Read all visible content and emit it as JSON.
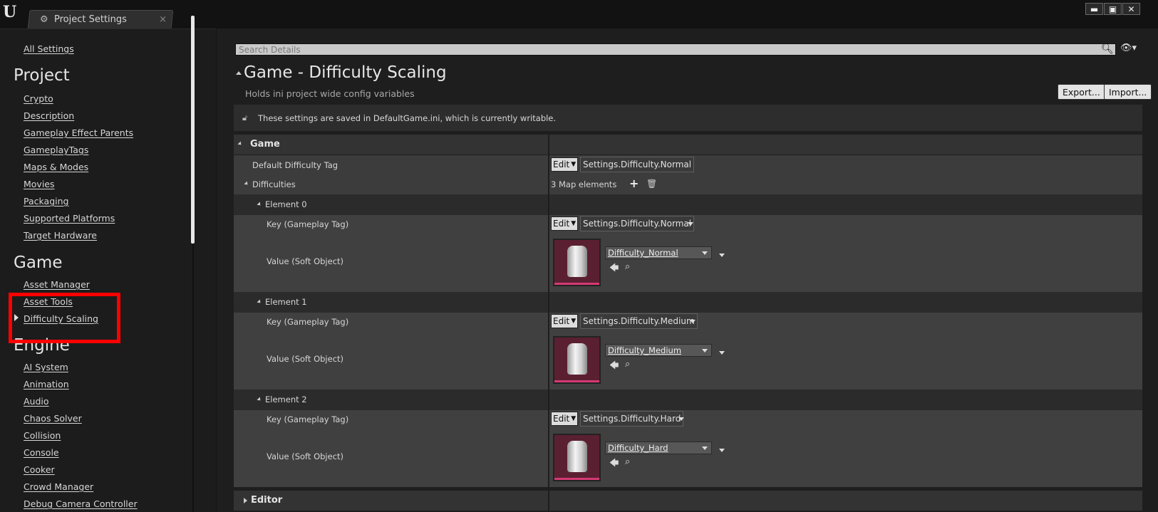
{
  "window": {
    "tab_title": "Project Settings",
    "tab_close": "×",
    "logo": "U",
    "buttons": {
      "minimize": "▬",
      "maximize": "▣",
      "close": "✕"
    }
  },
  "nav": {
    "all_settings": "All Settings",
    "project_heading": "Project",
    "project_items": [
      "Crypto",
      "Description",
      "Gameplay Effect Parents",
      "GameplayTags",
      "Maps & Modes",
      "Movies",
      "Packaging",
      "Supported Platforms",
      "Target Hardware"
    ],
    "game_heading": "Game",
    "game_items": [
      "Asset Manager",
      "Asset Tools",
      "Difficulty Scaling"
    ],
    "engine_heading": "Engine",
    "engine_items": [
      "AI System",
      "Animation",
      "Audio",
      "Chaos Solver",
      "Collision",
      "Console",
      "Cooker",
      "Crowd Manager",
      "Debug Camera Controller"
    ],
    "selected_item": "Difficulty Scaling"
  },
  "details": {
    "search_placeholder": "Search Details",
    "title": "Game - Difficulty Scaling",
    "subtitle": "Holds ini project wide config variables",
    "export_label": "Export...",
    "import_label": "Import...",
    "notice": "These settings are saved in DefaultGame.ini, which is currently writable.",
    "category_game": "Game",
    "category_editor": "Editor",
    "default_tag_label": "Default Difficulty Tag",
    "default_tag_value": "Settings.Difficulty.Normal",
    "edit_label": "Edit",
    "difficulties_label": "Difficulties",
    "map_count": "3 Map elements",
    "key_label": "Key (Gameplay Tag)",
    "value_label": "Value (Soft Object)",
    "elements": [
      {
        "name": "Element 0",
        "key": "Settings.Difficulty.Normal",
        "asset": "Difficulty_Normal"
      },
      {
        "name": "Element 1",
        "key": "Settings.Difficulty.Medium",
        "asset": "Difficulty_Medium"
      },
      {
        "name": "Element 2",
        "key": "Settings.Difficulty.Hard",
        "asset": "Difficulty_Hard"
      }
    ]
  },
  "icons": [
    "unreal-logo-icon",
    "settings-gear-icon",
    "search-icon",
    "eye-icon",
    "lock-icon",
    "add-icon",
    "trash-icon",
    "use-selected-icon",
    "browse-icon"
  ],
  "colors": {
    "highlight": "#ff0000",
    "thumbnail_bg": "#5a2032",
    "thumbnail_bar": "#d43a73"
  }
}
